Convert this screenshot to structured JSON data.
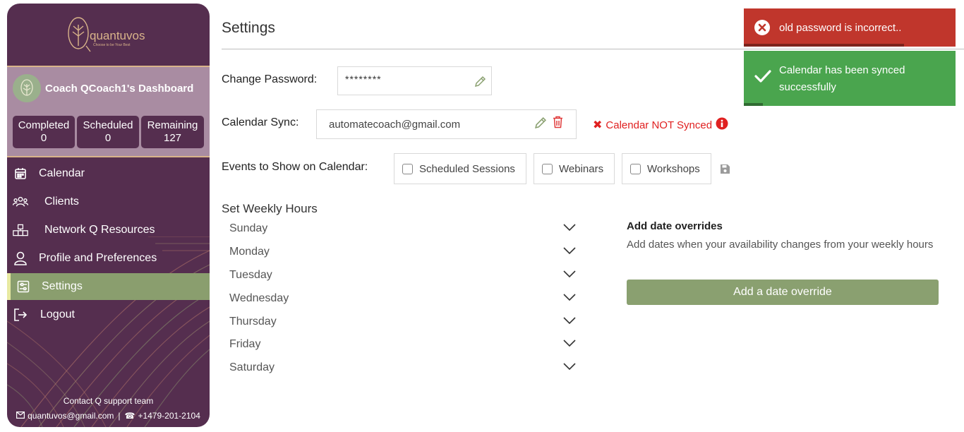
{
  "sidebar": {
    "logo": {
      "brand": "quantuvos",
      "tagline": "Choose to be Your Best"
    },
    "coach_name": "Coach QCoach1's Dashboard",
    "stats": [
      {
        "label": "Completed",
        "value": "0"
      },
      {
        "label": "Scheduled",
        "value": "0"
      },
      {
        "label": "Remaining",
        "value": "127"
      }
    ],
    "nav": [
      {
        "label": "Calendar",
        "icon": "calendar-icon",
        "active": false
      },
      {
        "label": "Clients",
        "icon": "users-icon",
        "active": false
      },
      {
        "label": "Network Q Resources",
        "icon": "network-icon",
        "active": false
      },
      {
        "label": "Profile and Preferences",
        "icon": "user-icon",
        "active": false
      },
      {
        "label": "Settings",
        "icon": "settings-icon",
        "active": true
      },
      {
        "label": "Logout",
        "icon": "logout-icon",
        "active": false
      }
    ],
    "contact_title": "Contact Q support team",
    "contact_email": "quantuvos@gmail.com",
    "contact_phone": "+1479-201-2104",
    "colors": {
      "background": "#552e4f",
      "accent": "#d9b48a",
      "active": "#8a9e6e"
    }
  },
  "main": {
    "title": "Settings",
    "password": {
      "label": "Change Password:",
      "value": "********"
    },
    "calendar_sync": {
      "label": "Calendar Sync:",
      "email": "automatecoach@gmail.com",
      "status": "Calendar NOT Synced"
    },
    "events": {
      "label": "Events to Show on Calendar:",
      "options": [
        {
          "label": "Scheduled Sessions",
          "checked": false
        },
        {
          "label": "Webinars",
          "checked": false
        },
        {
          "label": "Workshops",
          "checked": false
        }
      ]
    },
    "weekly_hours": {
      "title": "Set Weekly Hours",
      "days": [
        "Sunday",
        "Monday",
        "Tuesday",
        "Wednesday",
        "Thursday",
        "Friday",
        "Saturday"
      ]
    },
    "overrides": {
      "title": "Add date overrides",
      "description": "Add dates when your availability changes from your weekly hours",
      "button_label": "Add a date override"
    }
  },
  "toasts": [
    {
      "type": "error",
      "message": "old password is incorrect..",
      "progress": 0.75,
      "color": "#c0362c"
    },
    {
      "type": "success",
      "message": "Calendar has been synced successfully",
      "progress": 0.09,
      "color": "#4aa54e"
    }
  ]
}
